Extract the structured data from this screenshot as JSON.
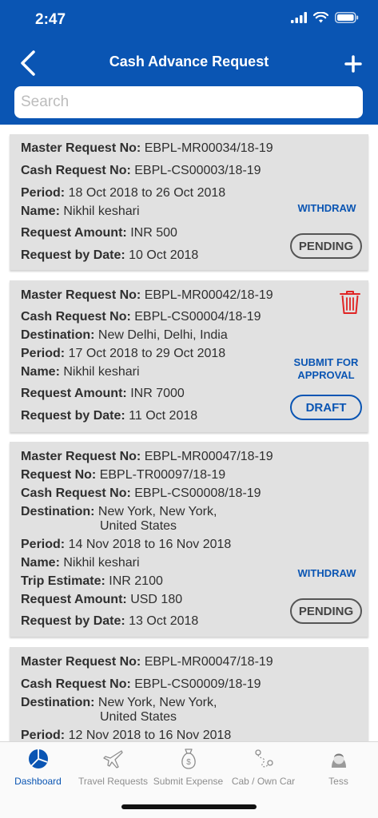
{
  "status_bar": {
    "time": "2:47"
  },
  "header": {
    "title": "Cash Advance Request"
  },
  "search": {
    "placeholder": "Search"
  },
  "colors": {
    "primary": "#0a55b3",
    "card_bg": "#e1e1e1",
    "delete": "#e02424"
  },
  "cards": [
    {
      "master_label": "Master Request No:",
      "master_value": "EBPL-MR00034/18-19",
      "cash_label": "Cash Request No:",
      "cash_value": "EBPL-CS00003/18-19",
      "period_label": "Period:",
      "period_value": "18 Oct 2018 to 26 Oct 2018",
      "name_label": "Name:",
      "name_value": "Nikhil keshari",
      "amount_label": "Request Amount:",
      "amount_value": "INR  500",
      "date_label": "Request by Date:",
      "date_value": "10 Oct 2018",
      "action": "WITHDRAW",
      "status": "PENDING"
    },
    {
      "master_label": "Master Request No:",
      "master_value": "EBPL-MR00042/18-19",
      "cash_label": "Cash Request No:",
      "cash_value": "EBPL-CS00004/18-19",
      "dest_label": "Destination:",
      "dest_value": "New Delhi, Delhi, India",
      "period_label": "Period:",
      "period_value": "17 Oct 2018 to 29 Oct 2018",
      "name_label": "Name:",
      "name_value": "Nikhil keshari",
      "amount_label": "Request Amount:",
      "amount_value": "INR  7000",
      "date_label": "Request by Date:",
      "date_value": "11 Oct 2018",
      "action_line1": "SUBMIT FOR",
      "action_line2": "APPROVAL",
      "status": "DRAFT",
      "delete_icon": "trash-icon"
    },
    {
      "master_label": "Master Request No:",
      "master_value": "EBPL-MR00047/18-19",
      "request_label": "Request No:",
      "request_value": "EBPL-TR00097/18-19",
      "cash_label": "Cash Request No:",
      "cash_value": "EBPL-CS00008/18-19",
      "dest_label": "Destination:",
      "dest_value_line1": "New York, New York,",
      "dest_value_line2": "United States",
      "period_label": "Period:",
      "period_value": "14 Nov 2018 to 16 Nov 2018",
      "name_label": "Name:",
      "name_value": "Nikhil keshari",
      "trip_label": "Trip Estimate:",
      "trip_value": "INR 2100",
      "amount_label": "Request Amount:",
      "amount_value": "USD  180",
      "date_label": "Request by Date:",
      "date_value": "13 Oct 2018",
      "action": "WITHDRAW",
      "status": "PENDING"
    },
    {
      "master_label": "Master Request No:",
      "master_value": "EBPL-MR00047/18-19",
      "cash_label": "Cash Request No:",
      "cash_value": "EBPL-CS00009/18-19",
      "dest_label": "Destination:",
      "dest_value_line1": "New York, New York,",
      "dest_value_line2": "United States",
      "period_label": "Period:",
      "period_value": "12 Nov 2018 to 16 Nov 2018"
    }
  ],
  "tabs": [
    {
      "label": "Dashboard",
      "icon": "pie-chart-icon",
      "active": true
    },
    {
      "label": "Travel Requests",
      "icon": "airplane-icon"
    },
    {
      "label": "Submit Expense",
      "icon": "money-bag-icon"
    },
    {
      "label": "Cab / Own Car",
      "icon": "route-icon"
    },
    {
      "label": "Tess",
      "icon": "assistant-avatar-icon"
    }
  ]
}
